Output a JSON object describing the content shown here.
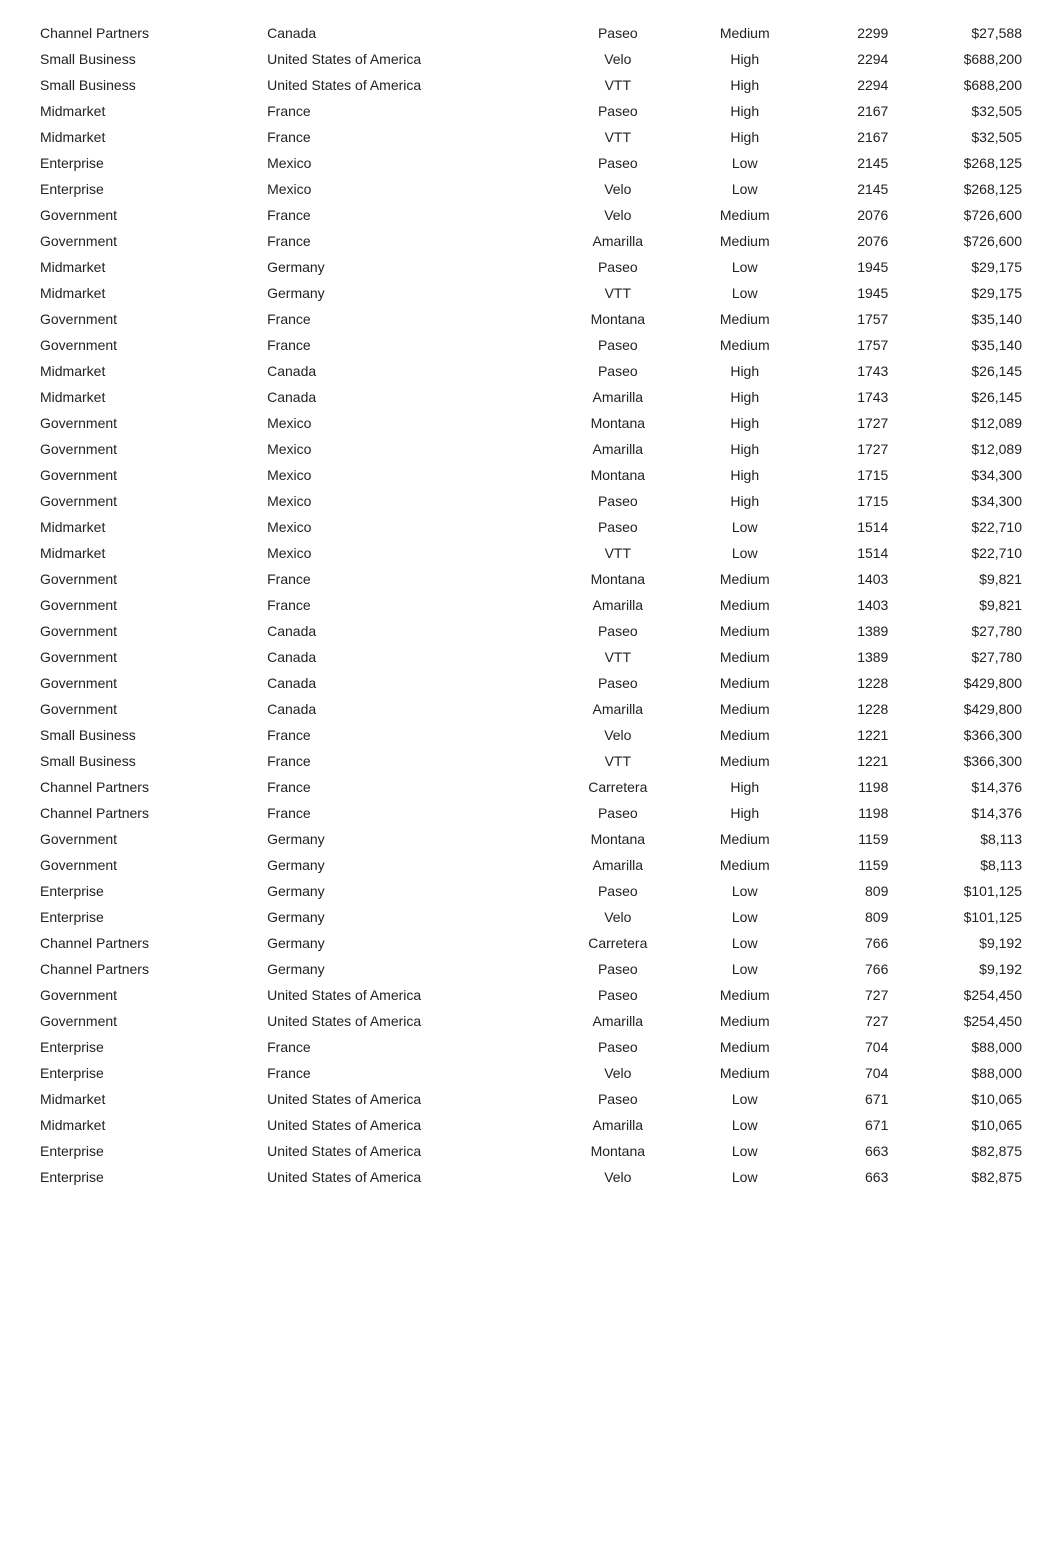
{
  "table": {
    "rows": [
      [
        "Channel Partners",
        "Canada",
        "Paseo",
        "Medium",
        "2299",
        "$27,588"
      ],
      [
        "Small Business",
        "United States of America",
        "Velo",
        "High",
        "2294",
        "$688,200"
      ],
      [
        "Small Business",
        "United States of America",
        "VTT",
        "High",
        "2294",
        "$688,200"
      ],
      [
        "Midmarket",
        "France",
        "Paseo",
        "High",
        "2167",
        "$32,505"
      ],
      [
        "Midmarket",
        "France",
        "VTT",
        "High",
        "2167",
        "$32,505"
      ],
      [
        "Enterprise",
        "Mexico",
        "Paseo",
        "Low",
        "2145",
        "$268,125"
      ],
      [
        "Enterprise",
        "Mexico",
        "Velo",
        "Low",
        "2145",
        "$268,125"
      ],
      [
        "Government",
        "France",
        "Velo",
        "Medium",
        "2076",
        "$726,600"
      ],
      [
        "Government",
        "France",
        "Amarilla",
        "Medium",
        "2076",
        "$726,600"
      ],
      [
        "Midmarket",
        "Germany",
        "Paseo",
        "Low",
        "1945",
        "$29,175"
      ],
      [
        "Midmarket",
        "Germany",
        "VTT",
        "Low",
        "1945",
        "$29,175"
      ],
      [
        "Government",
        "France",
        "Montana",
        "Medium",
        "1757",
        "$35,140"
      ],
      [
        "Government",
        "France",
        "Paseo",
        "Medium",
        "1757",
        "$35,140"
      ],
      [
        "Midmarket",
        "Canada",
        "Paseo",
        "High",
        "1743",
        "$26,145"
      ],
      [
        "Midmarket",
        "Canada",
        "Amarilla",
        "High",
        "1743",
        "$26,145"
      ],
      [
        "Government",
        "Mexico",
        "Montana",
        "High",
        "1727",
        "$12,089"
      ],
      [
        "Government",
        "Mexico",
        "Amarilla",
        "High",
        "1727",
        "$12,089"
      ],
      [
        "Government",
        "Mexico",
        "Montana",
        "High",
        "1715",
        "$34,300"
      ],
      [
        "Government",
        "Mexico",
        "Paseo",
        "High",
        "1715",
        "$34,300"
      ],
      [
        "Midmarket",
        "Mexico",
        "Paseo",
        "Low",
        "1514",
        "$22,710"
      ],
      [
        "Midmarket",
        "Mexico",
        "VTT",
        "Low",
        "1514",
        "$22,710"
      ],
      [
        "Government",
        "France",
        "Montana",
        "Medium",
        "1403",
        "$9,821"
      ],
      [
        "Government",
        "France",
        "Amarilla",
        "Medium",
        "1403",
        "$9,821"
      ],
      [
        "Government",
        "Canada",
        "Paseo",
        "Medium",
        "1389",
        "$27,780"
      ],
      [
        "Government",
        "Canada",
        "VTT",
        "Medium",
        "1389",
        "$27,780"
      ],
      [
        "Government",
        "Canada",
        "Paseo",
        "Medium",
        "1228",
        "$429,800"
      ],
      [
        "Government",
        "Canada",
        "Amarilla",
        "Medium",
        "1228",
        "$429,800"
      ],
      [
        "Small Business",
        "France",
        "Velo",
        "Medium",
        "1221",
        "$366,300"
      ],
      [
        "Small Business",
        "France",
        "VTT",
        "Medium",
        "1221",
        "$366,300"
      ],
      [
        "Channel Partners",
        "France",
        "Carretera",
        "High",
        "1198",
        "$14,376"
      ],
      [
        "Channel Partners",
        "France",
        "Paseo",
        "High",
        "1198",
        "$14,376"
      ],
      [
        "Government",
        "Germany",
        "Montana",
        "Medium",
        "1159",
        "$8,113"
      ],
      [
        "Government",
        "Germany",
        "Amarilla",
        "Medium",
        "1159",
        "$8,113"
      ],
      [
        "Enterprise",
        "Germany",
        "Paseo",
        "Low",
        "809",
        "$101,125"
      ],
      [
        "Enterprise",
        "Germany",
        "Velo",
        "Low",
        "809",
        "$101,125"
      ],
      [
        "Channel Partners",
        "Germany",
        "Carretera",
        "Low",
        "766",
        "$9,192"
      ],
      [
        "Channel Partners",
        "Germany",
        "Paseo",
        "Low",
        "766",
        "$9,192"
      ],
      [
        "Government",
        "United States of America",
        "Paseo",
        "Medium",
        "727",
        "$254,450"
      ],
      [
        "Government",
        "United States of America",
        "Amarilla",
        "Medium",
        "727",
        "$254,450"
      ],
      [
        "Enterprise",
        "France",
        "Paseo",
        "Medium",
        "704",
        "$88,000"
      ],
      [
        "Enterprise",
        "France",
        "Velo",
        "Medium",
        "704",
        "$88,000"
      ],
      [
        "Midmarket",
        "United States of America",
        "Paseo",
        "Low",
        "671",
        "$10,065"
      ],
      [
        "Midmarket",
        "United States of America",
        "Amarilla",
        "Low",
        "671",
        "$10,065"
      ],
      [
        "Enterprise",
        "United States of America",
        "Montana",
        "Low",
        "663",
        "$82,875"
      ],
      [
        "Enterprise",
        "United States of America",
        "Velo",
        "Low",
        "663",
        "$82,875"
      ]
    ]
  }
}
